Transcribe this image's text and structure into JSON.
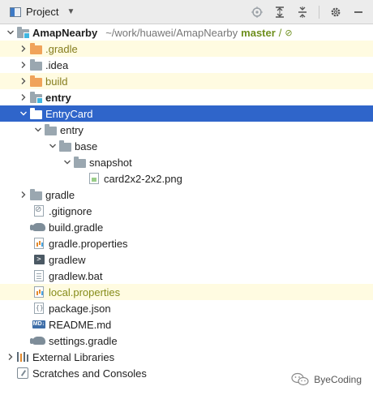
{
  "header": {
    "title": "Project",
    "dropdown_icon": "caret-down",
    "tools": [
      "locate-icon",
      "expand-all-icon",
      "collapse-all-icon",
      "gear-icon",
      "hide-icon"
    ]
  },
  "tree": {
    "root": {
      "name": "AmapNearby",
      "path": "~/work/huawei/AmapNearby",
      "branch": "master",
      "branch_suffix": "/"
    },
    "gradle_hidden": ".gradle",
    "idea": ".idea",
    "build": "build",
    "entry": "entry",
    "entrycard": "EntryCard",
    "entrycard_entry": "entry",
    "base": "base",
    "snapshot": "snapshot",
    "png": "card2x2-2x2.png",
    "gradle": "gradle",
    "gitignore": ".gitignore",
    "build_gradle": "build.gradle",
    "gradle_properties": "gradle.properties",
    "gradlew": "gradlew",
    "gradlew_bat": "gradlew.bat",
    "local_properties": "local.properties",
    "package_json": "package.json",
    "readme": "README.md",
    "settings_gradle": "settings.gradle",
    "external_libraries": "External Libraries",
    "scratches": "Scratches and Consoles"
  },
  "watermark": {
    "text": "ByeCoding"
  },
  "colors": {
    "selection": "#2f65ca",
    "excluded_highlight": "#fffbe1",
    "branch": "#6e8f1e",
    "module_folder": "#f0a35a"
  }
}
